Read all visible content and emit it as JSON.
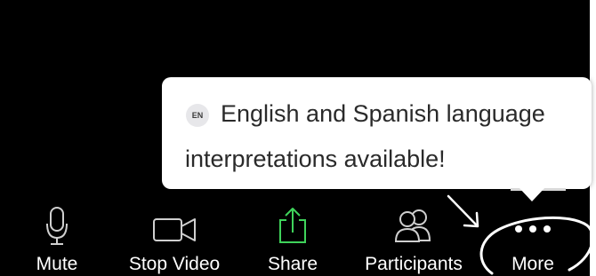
{
  "tooltip": {
    "badge": "EN",
    "message_line1": "English and Spanish language",
    "message_line2": "interpretations available!"
  },
  "toolbar": {
    "items": [
      {
        "label": "Mute",
        "icon": "microphone-icon"
      },
      {
        "label": "Stop Video",
        "icon": "video-camera-icon"
      },
      {
        "label": "Share",
        "icon": "share-upload-icon"
      },
      {
        "label": "Participants",
        "icon": "participants-icon"
      },
      {
        "label": "More",
        "icon": "more-dots-icon"
      }
    ]
  },
  "colors": {
    "background": "#000000",
    "tooltip": "#ffffff",
    "share_accent": "#3fd35b",
    "toolbar_text": "#ffffff"
  }
}
